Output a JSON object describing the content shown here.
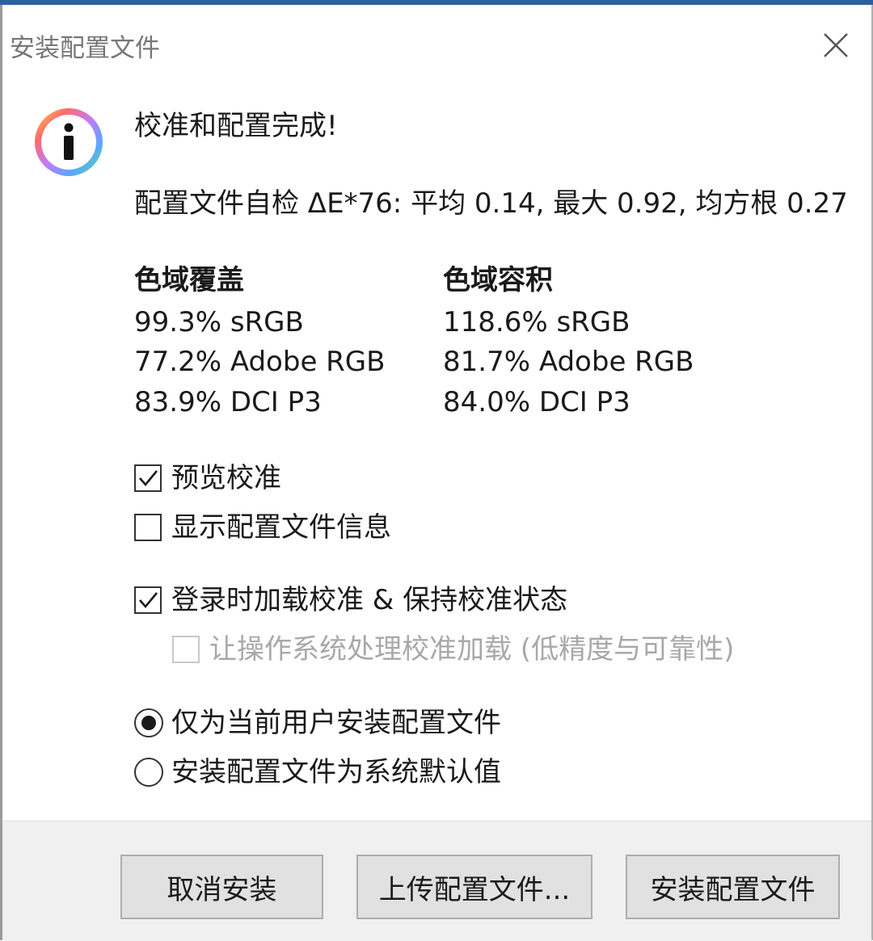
{
  "window": {
    "title": "安装配置文件"
  },
  "heading": "校准和配置完成!",
  "self_check": "配置文件自检 ΔE*76: 平均 0.14, 最大 0.92, 均方根 0.27",
  "gamut": {
    "coverage": {
      "title": "色域覆盖",
      "rows": [
        "99.3% sRGB",
        "77.2% Adobe RGB",
        "83.9% DCI P3"
      ]
    },
    "volume": {
      "title": "色域容积",
      "rows": [
        "118.6% sRGB",
        "81.7% Adobe RGB",
        "84.0% DCI P3"
      ]
    }
  },
  "options": {
    "preview_calibration": {
      "label": "预览校准",
      "checked": true
    },
    "show_profile_info": {
      "label": "显示配置文件信息",
      "checked": false
    },
    "load_on_login": {
      "label": "登录时加载校准 & 保持校准状态",
      "checked": true
    },
    "os_handles_loading": {
      "label": "让操作系统处理校准加载 (低精度与可靠性)",
      "checked": false,
      "enabled": false
    }
  },
  "install_scope": {
    "selected": "current_user",
    "current_user_label": "仅为当前用户安装配置文件",
    "system_default_label": "安装配置文件为系统默认值"
  },
  "buttons": {
    "cancel": "取消安装",
    "upload": "上传配置文件...",
    "install": "安装配置文件"
  },
  "colors": {
    "accent": "#2d5fa3",
    "footer_bg": "#f0f0f0",
    "button_bg": "#e1e1e1"
  }
}
